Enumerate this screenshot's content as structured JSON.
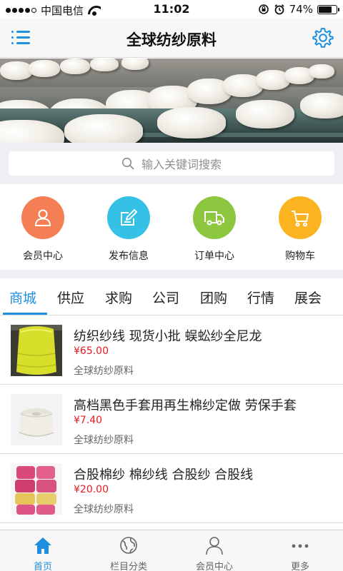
{
  "status_bar": {
    "carrier": "中国电信",
    "time": "11:02",
    "battery": "74%",
    "battery_level": 0.74,
    "icons": [
      "signal-icon",
      "wifi-icon",
      "rotation-lock-icon",
      "alarm-icon",
      "battery-icon"
    ]
  },
  "nav": {
    "title": "全球纺纱原料",
    "left_icon": "menu-icon",
    "right_icon": "gear-icon",
    "accent": "#1f8fe0"
  },
  "banner": {
    "slides": 2,
    "active_slide": 2
  },
  "search": {
    "placeholder": "输入关键词搜索"
  },
  "quick_links": [
    {
      "label": "会员中心",
      "icon": "user-icon",
      "color": "#f47f55"
    },
    {
      "label": "发布信息",
      "icon": "edit-icon",
      "color": "#35c0e6"
    },
    {
      "label": "订单中心",
      "icon": "truck-icon",
      "color": "#8dc63f"
    },
    {
      "label": "购物车",
      "icon": "cart-icon",
      "color": "#fbb320"
    }
  ],
  "tabs": [
    "商城",
    "供应",
    "求购",
    "公司",
    "团购",
    "行情",
    "展会"
  ],
  "active_tab": "商城",
  "products": [
    {
      "title": "纺织纱线 现货小批 蜈蚣纱全尼龙",
      "price": "¥65.00",
      "shop": "全球纺纱原料",
      "thumb": "yellow-yarn-cone"
    },
    {
      "title": "高档黑色手套用再生棉纱定做 劳保手套",
      "price": "¥7.40",
      "shop": "全球纺纱原料",
      "thumb": "white-yarn-cone"
    },
    {
      "title": "合股棉纱 棉纱线 合股纱 合股线",
      "price": "¥20.00",
      "shop": "全球纺纱原料",
      "thumb": "pink-yarn-stack"
    }
  ],
  "tabbar": [
    {
      "label": "首页",
      "icon": "home-icon",
      "active": true
    },
    {
      "label": "栏目分类",
      "icon": "globe-icon",
      "active": false
    },
    {
      "label": "会员中心",
      "icon": "person-icon",
      "active": false
    },
    {
      "label": "更多",
      "icon": "more-icon",
      "active": false
    }
  ],
  "colors": {
    "accent": "#1f8fe0",
    "price": "#e8191f",
    "background": "#efeff4"
  }
}
